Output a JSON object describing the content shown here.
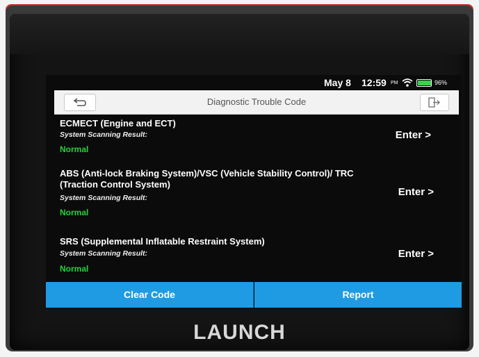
{
  "status_bar": {
    "date": "May 8",
    "time": "12:59",
    "ampm": "PM",
    "battery": "96%",
    "battery_level": 0.96
  },
  "header": {
    "title": "Diagnostic Trouble Code",
    "back_icon": "back-arrow-icon",
    "exit_icon": "exit-icon"
  },
  "systems": [
    {
      "name": "ECMECT (Engine and ECT)",
      "result_label": "System Scanning Result:",
      "status": "Normal",
      "action": "Enter >"
    },
    {
      "name": "ABS (Anti-lock Braking System)/VSC (Vehicle Stability Control)/ TRC (Traction Control System)",
      "result_label": "System Scanning Result:",
      "status": "Normal",
      "action": "Enter >"
    },
    {
      "name": "SRS (Supplemental Inflatable Restraint System)",
      "result_label": "System Scanning Result:",
      "status": "Normal",
      "action": "Enter >"
    }
  ],
  "footer": {
    "clear_label": "Clear Code",
    "report_label": "Report"
  },
  "device": {
    "brand": "LAUNCH"
  },
  "colors": {
    "accent": "#1f9be3",
    "status_ok": "#25d13b",
    "device_red": "#c0302f"
  }
}
